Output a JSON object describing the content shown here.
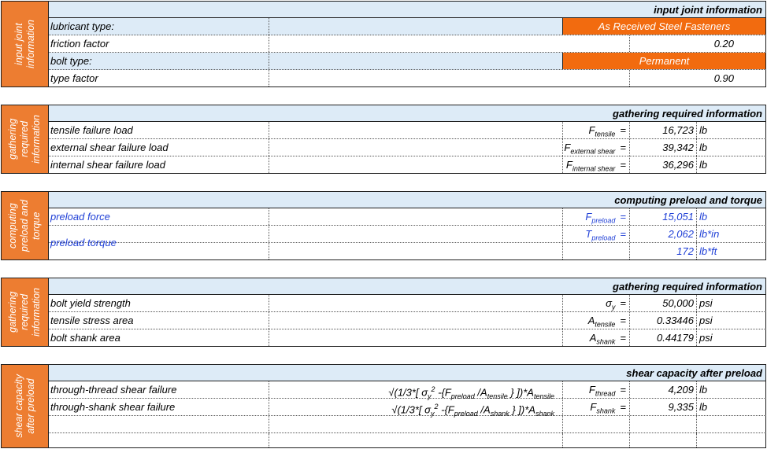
{
  "sections": [
    {
      "side": "input joint\ninformation",
      "header": "input joint information",
      "rows": [
        {
          "label": "lubricant type:",
          "value": "As Received Steel Fasteners"
        },
        {
          "label": "friction factor",
          "value": "0.20"
        },
        {
          "label": "bolt type:",
          "value": "Permanent"
        },
        {
          "label": "type factor",
          "value": "0.90"
        }
      ]
    },
    {
      "side": "gathering\nrequired\ninformation",
      "header": "gathering required information",
      "rows": [
        {
          "label": "tensile failure load",
          "sym": "F",
          "sub": "tensile",
          "value": "16,723",
          "unit": "lb"
        },
        {
          "label": "external shear failure load",
          "sym": "F",
          "sub": "external shear",
          "value": "39,342",
          "unit": "lb"
        },
        {
          "label": "internal shear failure load",
          "sym": "F",
          "sub": "internal shear",
          "value": "36,296",
          "unit": "lb"
        }
      ]
    },
    {
      "side": "computing\npreload and\ntorque",
      "header": "computing preload and torque",
      "rows": [
        {
          "label": "preload force",
          "sym": "F",
          "sub": "preload",
          "value": "15,051",
          "unit": "lb"
        },
        {
          "label": "preload torque",
          "sym": "T",
          "sub": "preload",
          "value": "2,062",
          "unit": "lb*in"
        },
        {
          "value": "172",
          "unit": "lb*ft"
        }
      ]
    },
    {
      "side": "gathering\nrequired\ninformation",
      "header": "gathering required information",
      "rows": [
        {
          "label": "bolt yield strength",
          "sym": "σ",
          "sub": "y",
          "value": "50,000",
          "unit": "psi"
        },
        {
          "label": "tensile stress area",
          "sym": "A",
          "sub": "tensile",
          "value": "0.33446",
          "unit": "psi"
        },
        {
          "label": "bolt shank area",
          "sym": "A",
          "sub": "shank",
          "value": "0.44179",
          "unit": "psi"
        }
      ]
    },
    {
      "side": "shear capacity\nafter preload",
      "header": "shear capacity after preload",
      "rows": [
        {
          "label": "through-thread shear failure",
          "formula_area": "tensile",
          "sym": "F",
          "sub": "thread",
          "value": "4,209",
          "unit": "lb"
        },
        {
          "label": "through-shank shear failure",
          "formula_area": "shank",
          "sym": "F",
          "sub": "shank",
          "value": "9,335",
          "unit": "lb"
        }
      ]
    }
  ],
  "formula_parts": {
    "open": "√(1/3*[ ",
    "sigma": "σ",
    "sigma_sub": "y",
    "sq": "2",
    "mid": " -{F",
    "preload_sub": "preload",
    "slash": " /A",
    "close": " } ])*A"
  },
  "eq_sign": "=",
  "colors": {
    "accent_orange": "#ed7d31",
    "header_blue": "#ddebf7",
    "blue_text": "#1f3fd6"
  }
}
